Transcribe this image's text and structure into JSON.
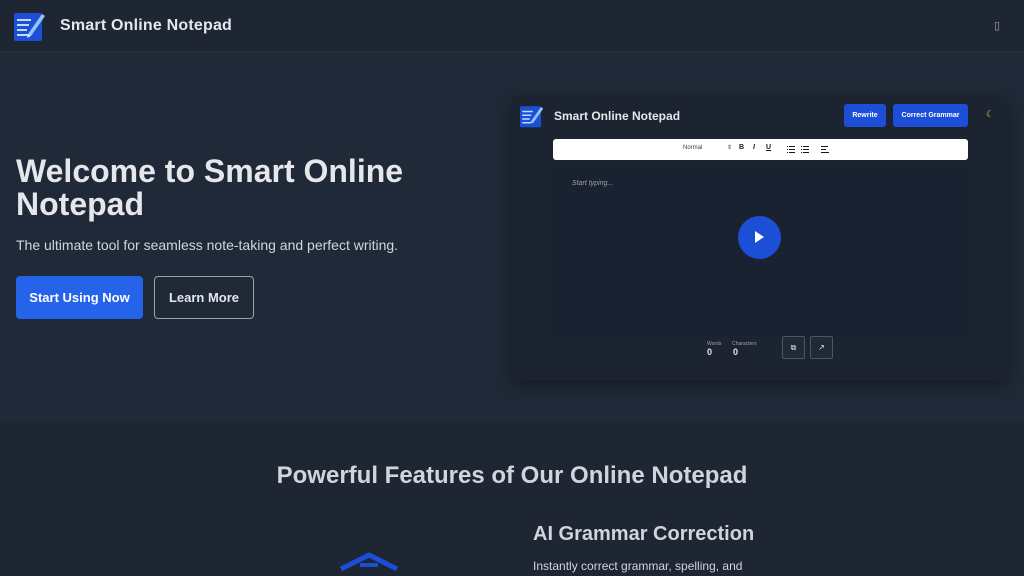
{
  "nav": {
    "title": "Smart Online Notepad",
    "menu_glyph": "▯"
  },
  "hero": {
    "title": "Welcome to Smart Online Notepad",
    "subtitle": "The ultimate tool for seamless note-taking and perfect writing.",
    "primary_button": "Start Using Now",
    "secondary_button": "Learn More"
  },
  "preview": {
    "title": "Smart Online Notepad",
    "rewrite_button": "Rewrite",
    "grammar_button": "Correct Grammar",
    "toolbar": {
      "format_select": "Normal",
      "bold": "B",
      "italic": "I",
      "underline": "U"
    },
    "placeholder": "Start typing...",
    "words_label": "Words",
    "words_value": "0",
    "characters_label": "Characters",
    "characters_value": "0"
  },
  "features": {
    "title": "Powerful Features of Our Online Notepad",
    "feature_title": "AI Grammar Correction",
    "feature_text": "Instantly correct grammar, spelling, and"
  },
  "colors": {
    "accent": "#2563eb",
    "background": "#1f2937",
    "moon": "#facc15"
  }
}
